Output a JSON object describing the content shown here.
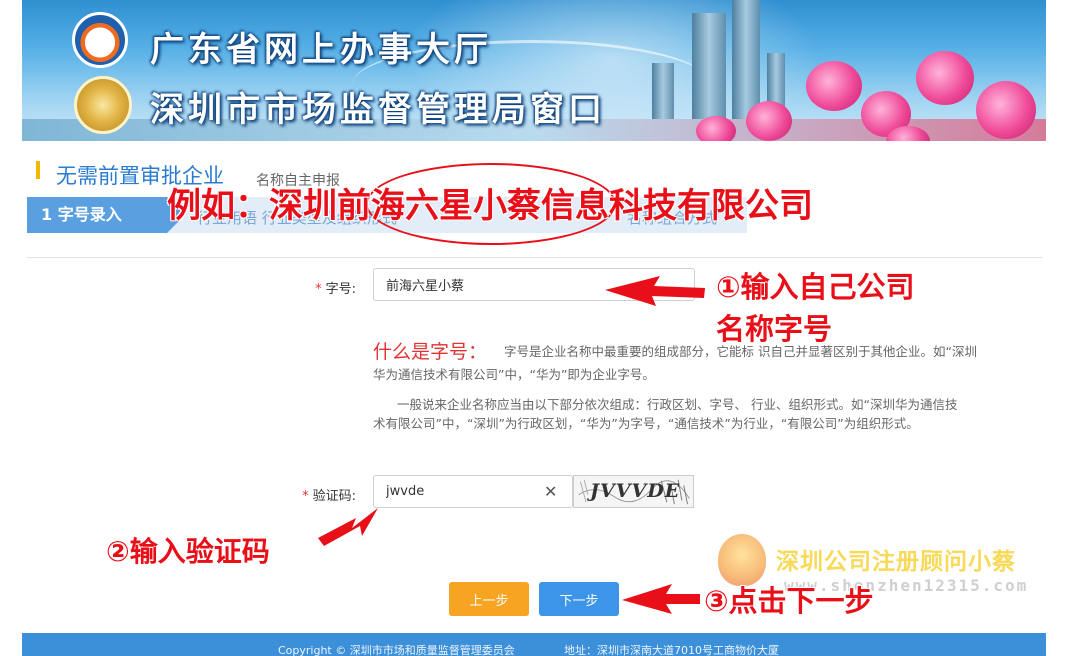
{
  "banner": {
    "title_line1": "广东省网上办事大厅",
    "title_line2": "深圳市市场监督管理局窗口"
  },
  "page": {
    "title": "无需前置审批企业",
    "subtitle": "名称自主申报"
  },
  "steps": {
    "active_label": "1 字号录入",
    "hint_a": "行业用语        行业类型及组织形式",
    "hint_b": "名称组合方式"
  },
  "form": {
    "name_label": "字号:",
    "name_value": "前海六星小蔡",
    "captcha_label": "验证码:",
    "captcha_value": "jwvde",
    "captcha_image_text": "JVVVDE",
    "required_mark": "*"
  },
  "help": {
    "title": "什么是字号：",
    "para1_line1": "字号是企业名称中最重要的组成部分，它能标 识自己并显著区别于其他企业。如“深圳",
    "para1_line2": "华为通信技术有限公司”中，“华为”即为企业字号。",
    "para2_line1": "一般说来企业名称应当由以下部分依次组成：行政区划、字号、 行业、组织形式。如“深圳华为通信技",
    "para2_line2": "术有限公司”中，“深圳”为行政区划，“华为”为字号，“通信技术”为行业，“有限公司”为组织形式。"
  },
  "buttons": {
    "prev": "上一步",
    "next": "下一步"
  },
  "footer": {
    "copyright": "Copyright ©  深圳市市场和质量监督管理委员会",
    "address": "地址：深圳市深南大道7010号工商物价大厦"
  },
  "annotations": {
    "example": "例如：深圳前海六星小蔡信息科技有限公司",
    "step1_line1": "①输入自己公司",
    "step1_line2": "名称字号",
    "step2": "②输入验证码",
    "step3": "③点击下一步"
  },
  "watermark": {
    "text": "深圳公司注册顾问小蔡",
    "url": "www.shenzhen12315.com"
  },
  "colors": {
    "accent_blue": "#3c95e8",
    "prev_orange": "#f7a422",
    "annotation_red": "#e80f18",
    "title_blue": "#2a7bd1"
  }
}
